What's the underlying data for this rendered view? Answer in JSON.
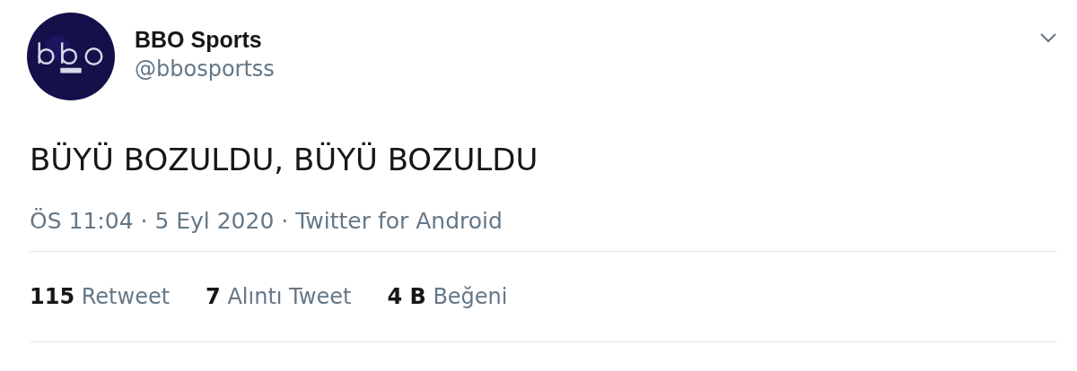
{
  "author": {
    "name": "BBO Sports",
    "handle": "@bbosportss"
  },
  "tweet": {
    "text": "BÜYÜ BOZULDU, BÜYÜ BOZULDU",
    "meta": "ÖS 11:04 · 5 Eyl 2020 · Twitter for Android"
  },
  "stats": [
    {
      "count": "115",
      "label": "Retweet"
    },
    {
      "count": "7",
      "label": "Alıntı Tweet"
    },
    {
      "count": "4 B",
      "label": "Beğeni"
    }
  ]
}
